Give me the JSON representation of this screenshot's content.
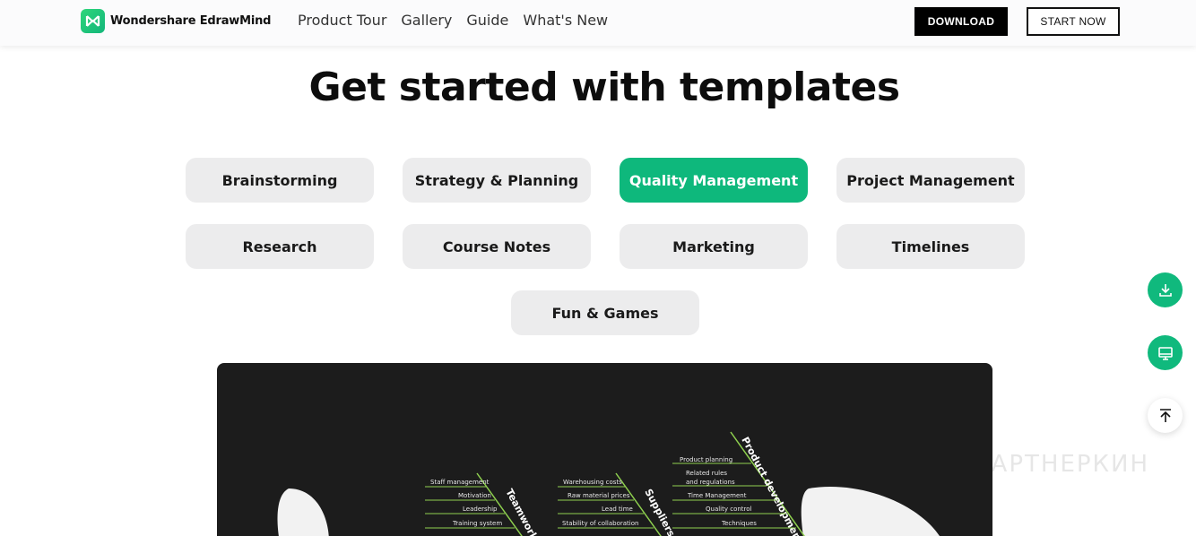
{
  "header": {
    "brand": "Wondershare EdrawMind",
    "nav": [
      "Product Tour",
      "Gallery",
      "Guide",
      "What's New"
    ],
    "download_label": "DOWNLOAD",
    "start_label": "START NOW"
  },
  "title": "Get started with templates",
  "categories": [
    {
      "label": "Brainstorming",
      "active": false
    },
    {
      "label": "Strategy & Planning",
      "active": false
    },
    {
      "label": "Quality Management",
      "active": true
    },
    {
      "label": "Project Management",
      "active": false
    },
    {
      "label": "Research",
      "active": false
    },
    {
      "label": "Course Notes",
      "active": false
    },
    {
      "label": "Marketing",
      "active": false
    },
    {
      "label": "Timelines",
      "active": false
    },
    {
      "label": "Fun & Games",
      "active": false
    }
  ],
  "side_buttons": [
    "download-icon",
    "desktop-icon",
    "back-to-top-icon"
  ],
  "preview": {
    "branches": [
      {
        "name": "Teamwork",
        "items": [
          "Staff management",
          "Motivation",
          "Leadership",
          "Training system"
        ]
      },
      {
        "name": "Suppliers",
        "items": [
          "Warehousing costs",
          "Raw material prices",
          "Lead time",
          "Stability of collaboration"
        ]
      },
      {
        "name": "Product development",
        "items": [
          "Product planning",
          "Related rules",
          "and regulations",
          "Time Management",
          "Quality control",
          "Techniques"
        ]
      }
    ]
  },
  "watermark": "ПАРТНЕРКИН",
  "colors": {
    "accent": "#0eb87c",
    "pill": "#ececed",
    "panel": "#1c1c1c"
  }
}
